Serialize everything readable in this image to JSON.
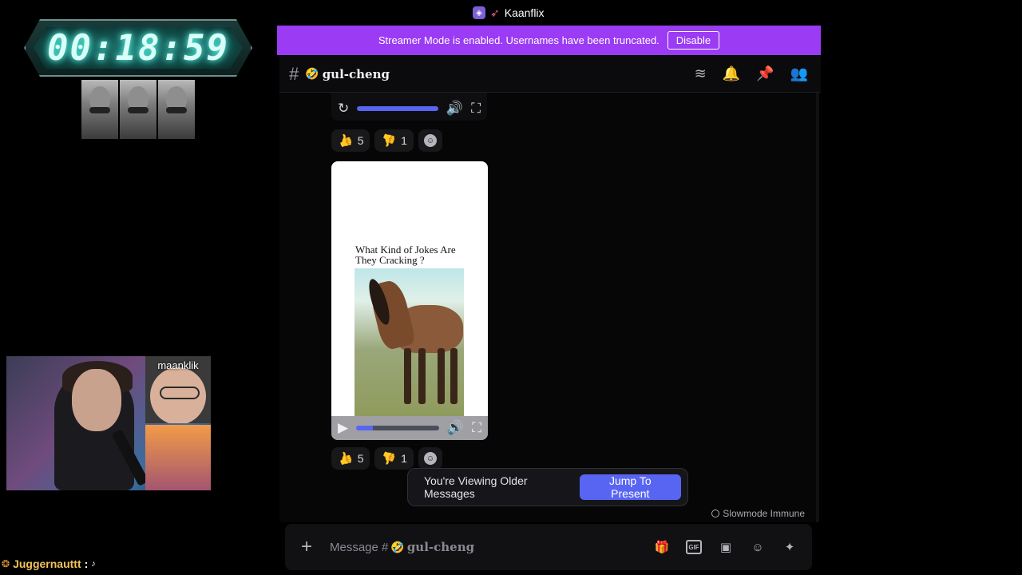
{
  "stream": {
    "timer": "00:18:59",
    "webcam_label": "maanklik",
    "chat": {
      "user": "Juggernauttt",
      "separator": ":"
    }
  },
  "app": {
    "title": "Kaanflix"
  },
  "banner": {
    "text": "Streamer Mode is enabled. Usernames have been truncated.",
    "button": "Disable"
  },
  "channel": {
    "name": "gul-cheng",
    "icons": [
      "threads-icon",
      "bell-icon",
      "pin-icon",
      "members-icon"
    ]
  },
  "messages": {
    "reactions_1": {
      "up": "5",
      "down": "1"
    },
    "video_caption": "What Kind of Jokes Are They Cracking ?",
    "reactions_2": {
      "up": "5",
      "down": "1"
    },
    "older_notice": "You're Viewing Older Messages",
    "jump_button": "Jump To Present",
    "slowmode": "Slowmode Immune"
  },
  "composer": {
    "placeholder_prefix": "Message #",
    "channel": "gul-cheng",
    "tools": [
      "gift-icon",
      "gif-icon",
      "sticker-icon",
      "emoji-icon",
      "apps-icon"
    ]
  },
  "colors": {
    "banner": "#9b3bf4",
    "accent": "#5865f2",
    "thumb_up": "#52c2b6",
    "thumb_down": "#e96a86"
  }
}
